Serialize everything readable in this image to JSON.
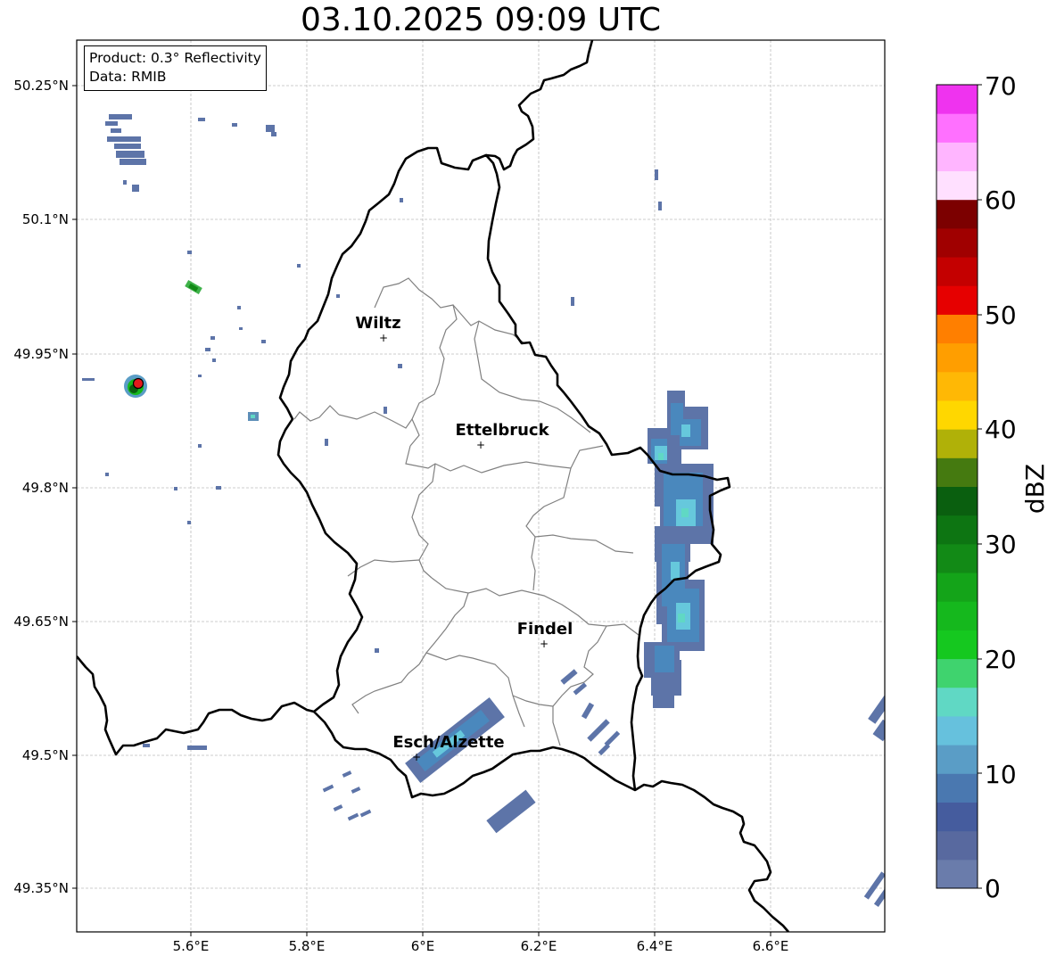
{
  "title": "03.10.2025 09:09 UTC",
  "info": {
    "product": "Product: 0.3° Reflectivity",
    "data_source": "Data: RMIB"
  },
  "axes": {
    "lon_ticks": [
      "5.6°E",
      "5.8°E",
      "6°E",
      "6.2°E",
      "6.4°E",
      "6.6°E"
    ],
    "lat_ticks": [
      "50.25°N",
      "50.1°N",
      "49.95°N",
      "49.8°N",
      "49.65°N",
      "49.5°N",
      "49.35°N"
    ]
  },
  "cities": [
    {
      "name": "Wiltz",
      "lon": 5.93,
      "lat": 49.97
    },
    {
      "name": "Ettelbruck",
      "lon": 6.1,
      "lat": 49.85
    },
    {
      "name": "Findel",
      "lon": 6.21,
      "lat": 49.63
    },
    {
      "name": "Esch/Alzette",
      "lon": 5.99,
      "lat": 49.5
    }
  ],
  "radar_site": {
    "lon": 5.51,
    "lat": 49.92,
    "color": "#e41a1c"
  },
  "colorbar": {
    "label": "dBZ",
    "ticks": [
      "0",
      "10",
      "20",
      "30",
      "40",
      "50",
      "60",
      "70"
    ],
    "min": 0,
    "max": 70,
    "step": 2.5,
    "colors": [
      "#6a7cab",
      "#58699f",
      "#455c9e",
      "#4a78b0",
      "#5a9dc6",
      "#66c1dd",
      "#60d8c4",
      "#3fd36e",
      "#15c81f",
      "#15b81d",
      "#14a419",
      "#128a16",
      "#0d7512",
      "#0a5f0f",
      "#457a10",
      "#b0b108",
      "#ffd700",
      "#ffb805",
      "#ff9e00",
      "#ff7f00",
      "#e60000",
      "#c40000",
      "#a00000",
      "#7c0000",
      "#ffe0ff",
      "#ffb5ff",
      "#ff70ff",
      "#ef33ef"
    ]
  },
  "colors": {
    "border": "#000000",
    "commune": "#808080",
    "grid": "#bdbdbd",
    "echo_weak": "#5d74a8",
    "echo_mid": "#4a90c2",
    "echo_strong": "#66c8dc"
  }
}
